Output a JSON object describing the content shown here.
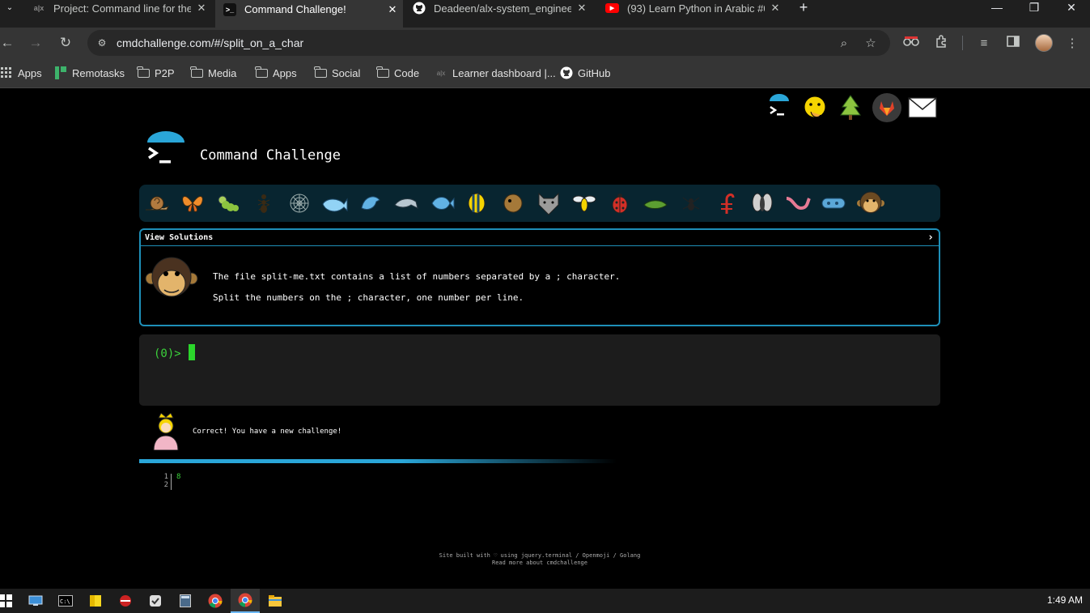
{
  "browser": {
    "tabs": [
      {
        "title": "Project: Command line for the v",
        "icon": "alx-icon"
      },
      {
        "title": "Command Challenge!",
        "icon": "terminal-icon",
        "active": true
      },
      {
        "title": "Deadeen/alx-system_engineeri",
        "icon": "github-icon"
      },
      {
        "title": "(93) Learn Python in Arabic #01",
        "icon": "youtube-icon"
      }
    ],
    "url": "cmdchallenge.com/#/split_on_a_char",
    "bookmarks": [
      {
        "label": "Apps",
        "icon": "apps-grid-icon"
      },
      {
        "label": "Remotasks",
        "icon": "remotasks-icon"
      },
      {
        "label": "P2P",
        "icon": "folder-icon"
      },
      {
        "label": "Media",
        "icon": "folder-icon"
      },
      {
        "label": "Apps",
        "icon": "folder-icon"
      },
      {
        "label": "Social",
        "icon": "folder-icon"
      },
      {
        "label": "Code",
        "icon": "folder-icon"
      },
      {
        "label": "Learner dashboard |...",
        "icon": "alx-icon"
      },
      {
        "label": "GitHub",
        "icon": "github-icon"
      }
    ]
  },
  "site": {
    "title": "Command Challenge",
    "solutions_label": "View Solutions",
    "challenge_line1": "The file split-me.txt contains a list of numbers separated by a ; character.",
    "challenge_line2": "Split the numbers on the ; character, one number per line.",
    "prompt": "(0)>",
    "feedback": "Correct! You have a new challenge!",
    "progress_fraction": 0.59,
    "output": {
      "line_numbers": [
        "1",
        "2"
      ],
      "values": [
        "8",
        ""
      ]
    },
    "footer_line1": "Site built with ♡ using jquery.terminal / Openmoji / Golang",
    "footer_line2": "Read more about cmdchallenge"
  },
  "taskbar": {
    "clock": "1:49 AM"
  },
  "colors": {
    "accent": "#1e8fb8",
    "terminal_green": "#3bd23b",
    "emoji_bar_bg": "#082530"
  }
}
